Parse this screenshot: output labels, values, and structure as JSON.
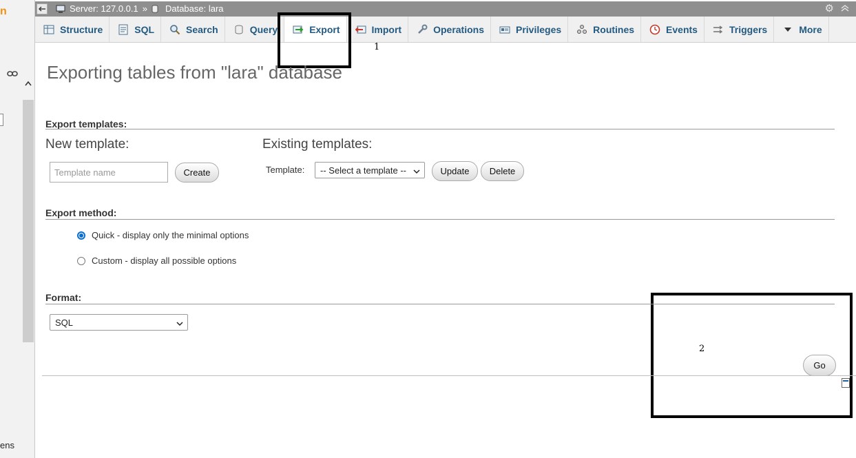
{
  "left_nav": {
    "logo_fragment": "n",
    "bottom_fragment": "ens"
  },
  "topbar": {
    "server_label": "Server: 127.0.0.1",
    "separator": "»",
    "database_label": "Database: lara"
  },
  "tabs": [
    {
      "label": "Structure",
      "icon": "structure-icon"
    },
    {
      "label": "SQL",
      "icon": "sql-icon"
    },
    {
      "label": "Search",
      "icon": "search-icon"
    },
    {
      "label": "Query",
      "icon": "query-icon"
    },
    {
      "label": "Export",
      "icon": "export-icon",
      "active": true
    },
    {
      "label": "Import",
      "icon": "import-icon"
    },
    {
      "label": "Operations",
      "icon": "wrench-icon"
    },
    {
      "label": "Privileges",
      "icon": "privileges-icon"
    },
    {
      "label": "Routines",
      "icon": "routines-icon"
    },
    {
      "label": "Events",
      "icon": "clock-icon"
    },
    {
      "label": "Triggers",
      "icon": "triggers-icon"
    },
    {
      "label": "More",
      "icon": "caret-down-icon"
    }
  ],
  "annotations": {
    "box1_label": "1",
    "box2_label": "2"
  },
  "page_title": "Exporting tables from \"lara\" database",
  "export_templates": {
    "section_label": "Export templates:",
    "new_template_heading": "New template:",
    "template_name_placeholder": "Template name",
    "create_label": "Create",
    "existing_templates_heading": "Existing templates:",
    "template_label": "Template:",
    "template_select_value": "-- Select a template --",
    "update_label": "Update",
    "delete_label": "Delete"
  },
  "export_method": {
    "section_label": "Export method:",
    "quick_label": "Quick - display only the minimal options",
    "custom_label": "Custom - display all possible options",
    "selected": "quick"
  },
  "format": {
    "section_label": "Format:",
    "selected_value": "SQL"
  },
  "go_label": "Go",
  "colors": {
    "tab_text": "#235a81",
    "radio_accent": "#0a6ed1",
    "topbar_bg": "#8f8f8f"
  }
}
